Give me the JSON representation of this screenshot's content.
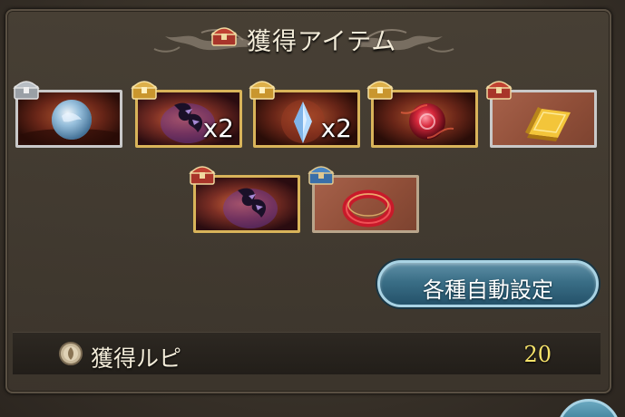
{
  "header": {
    "title": "獲得アイテム",
    "icon": "treasure-chest-icon"
  },
  "items": [
    {
      "name": "blue-orb",
      "frame": "silver",
      "chest": "silver",
      "quantity": ""
    },
    {
      "name": "dark-claw",
      "frame": "gold",
      "chest": "gold",
      "quantity": "x2"
    },
    {
      "name": "crystal-shard",
      "frame": "gold",
      "chest": "gold",
      "quantity": "x2"
    },
    {
      "name": "red-orb",
      "frame": "gold",
      "chest": "gold",
      "quantity": ""
    },
    {
      "name": "gold-brick",
      "frame": "silver",
      "chest": "red",
      "quantity": ""
    },
    {
      "name": "dark-claw",
      "frame": "gold",
      "chest": "red",
      "quantity": ""
    },
    {
      "name": "red-ring",
      "frame": "bronze",
      "chest": "blue",
      "quantity": ""
    }
  ],
  "settings_button": {
    "label": "各種自動設定"
  },
  "rupie": {
    "label": "獲得ルピ",
    "value": "20",
    "icon": "rupie-coin-icon"
  },
  "colors": {
    "rupie_value": "#f7e36a",
    "button_accent": "#3a6e86",
    "gold_frame": "#d9b45a",
    "silver_frame": "#c9c9c9"
  }
}
